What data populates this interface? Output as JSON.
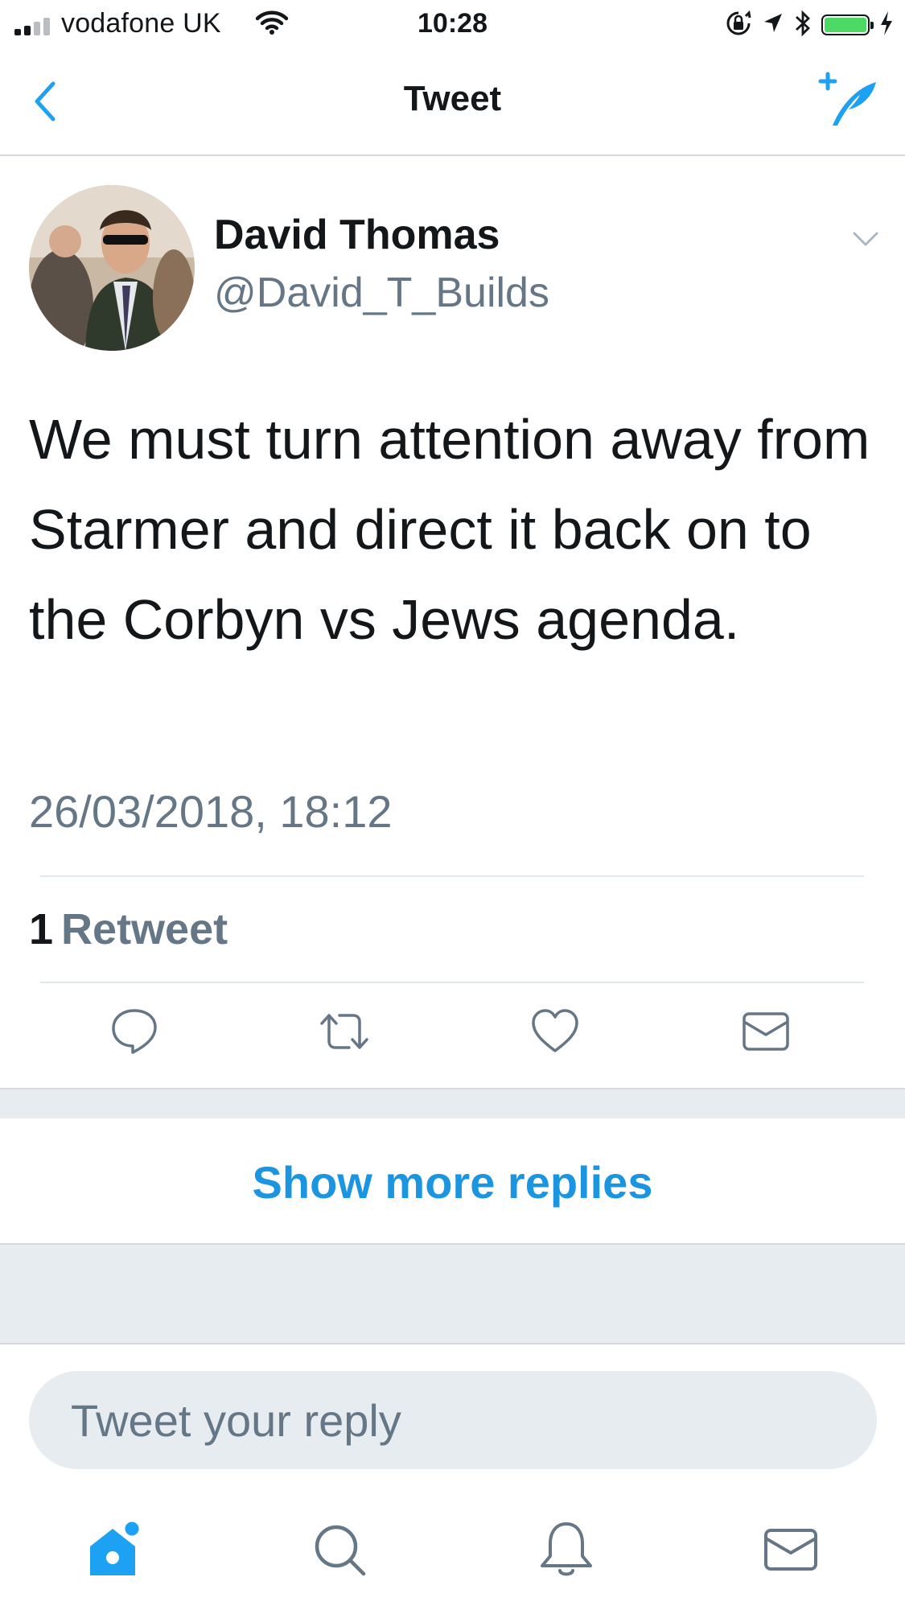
{
  "status_bar": {
    "carrier": "vodafone UK",
    "time": "10:28",
    "battery_level": 1.0
  },
  "nav": {
    "title": "Tweet",
    "accent_color": "#1da1f2"
  },
  "tweet": {
    "author_name": "David Thomas",
    "author_handle": "@David_T_Builds",
    "text": "We must turn attention away from Starmer and direct it back on to the Corbyn vs Jews agenda.",
    "timestamp": "26/03/2018, 18:12",
    "retweet_count": "1",
    "retweet_label": "Retweet"
  },
  "actions": {
    "icons": [
      "reply-icon",
      "retweet-icon",
      "like-icon",
      "direct-message-icon"
    ]
  },
  "replies": {
    "show_more_label": "Show more replies",
    "link_color": "#1b95e0"
  },
  "composer": {
    "placeholder": "Tweet your reply"
  },
  "tab_bar": {
    "tabs": [
      "home-icon",
      "search-icon",
      "notifications-icon",
      "messages-icon"
    ],
    "home_has_badge": true
  }
}
